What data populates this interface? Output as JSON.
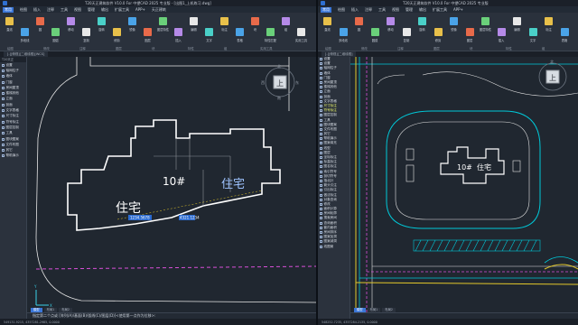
{
  "left": {
    "title": "T20天正建筑软件 V10.0 For 中望CAD 2025 专业版 - [出图1_上机练习.dwg]",
    "menu": [
      "常用",
      "绘图",
      "插入",
      "注释",
      "工具",
      "视图",
      "管理",
      "输出",
      "扩展工具",
      "APP+",
      "天正建筑"
    ],
    "ribbon_buttons": [
      "直线",
      "多段线",
      "圆",
      "圆弧",
      "移动",
      "复制",
      "旋转",
      "修剪",
      "镜像",
      "图层",
      "图层特性",
      "插入",
      "编辑",
      "文字",
      "标注",
      "表格",
      "块",
      "特性匹配",
      "组",
      "实用工具",
      "剪贴板"
    ],
    "groups": [
      "绘图",
      "修改",
      "注释",
      "图层",
      "块",
      "特性",
      "组",
      "实用工具"
    ],
    "doc_tabs": [
      "[-][俯视][二维线框][WCS]"
    ],
    "sidebar_header": "T20天正",
    "sidebar_items": [
      "设置",
      "轴网柱子",
      "墙体",
      "门窗",
      "房间屋顶",
      "楼梯其他",
      "立面",
      "剖面",
      "文字表格",
      "尺寸标注",
      "符号标注",
      "图层控制",
      "工具",
      "图块图案",
      "文件布图",
      "其它",
      "帮助演示"
    ],
    "labels": {
      "building_no": "10#",
      "residence_a": "住宅",
      "residence_b": "住宅"
    },
    "viewcube": {
      "top": "上",
      "north": "北",
      "south": "南",
      "east": "东",
      "west": "西"
    },
    "dyn_inputs": [
      "1234.5678",
      "4321.1234"
    ],
    "command": "指定第二个点或 [阵列(A)/基面(B)/弧线(C)/图层(D)]<使用第一点作为位移>:",
    "layout_tabs": [
      "模型",
      "布局1",
      "布局2"
    ],
    "status": "549131.9215, 4357281.2985, 0.0000"
  },
  "right": {
    "title": "T20天正建筑软件 V10.0 For 中望CAD 2025 专业版",
    "menu": [
      "常用",
      "绘图",
      "插入",
      "注释",
      "工具",
      "视图",
      "管理",
      "输出",
      "扩展工具",
      "APP+"
    ],
    "doc_tabs": [
      "[-][俯视][二维线框]"
    ],
    "sidebar_items": [
      "设置",
      "设置",
      "轴网柱子",
      "墙体",
      "门窗",
      "房间屋顶",
      "楼梯其他",
      "立面",
      "剖面",
      "文字表格",
      "尺寸标注",
      "符号标注",
      "图层控制",
      "工具",
      "图块图案",
      "文件布图",
      "其它",
      "帮助演示",
      "图案填充",
      "线型",
      "图层",
      "坐标标注",
      "标高标注",
      "图名标注",
      "索引符号",
      "剖切符号",
      "指北针",
      "箭头引注",
      "引出标注",
      "做法标注",
      "对象查询",
      "修改",
      "面积计算",
      "房间轮廓",
      "搜索房间",
      "查询面积",
      "套内面积",
      "房间排序",
      "图案加洞",
      "图案减洞",
      "线图案"
    ],
    "labels": {
      "building_no": "10#",
      "residence": "住宅"
    },
    "viewcube": {
      "top": "上",
      "north": "北"
    },
    "status": "548252.7235, 4357284.2135, 0.0000"
  },
  "colors": {
    "bg": "#212830",
    "wall": "#ffffff",
    "cyan": "#00c8d8",
    "magenta": "#d74fd7",
    "yellow": "#e4c82a",
    "blue": "#3a76d8"
  }
}
